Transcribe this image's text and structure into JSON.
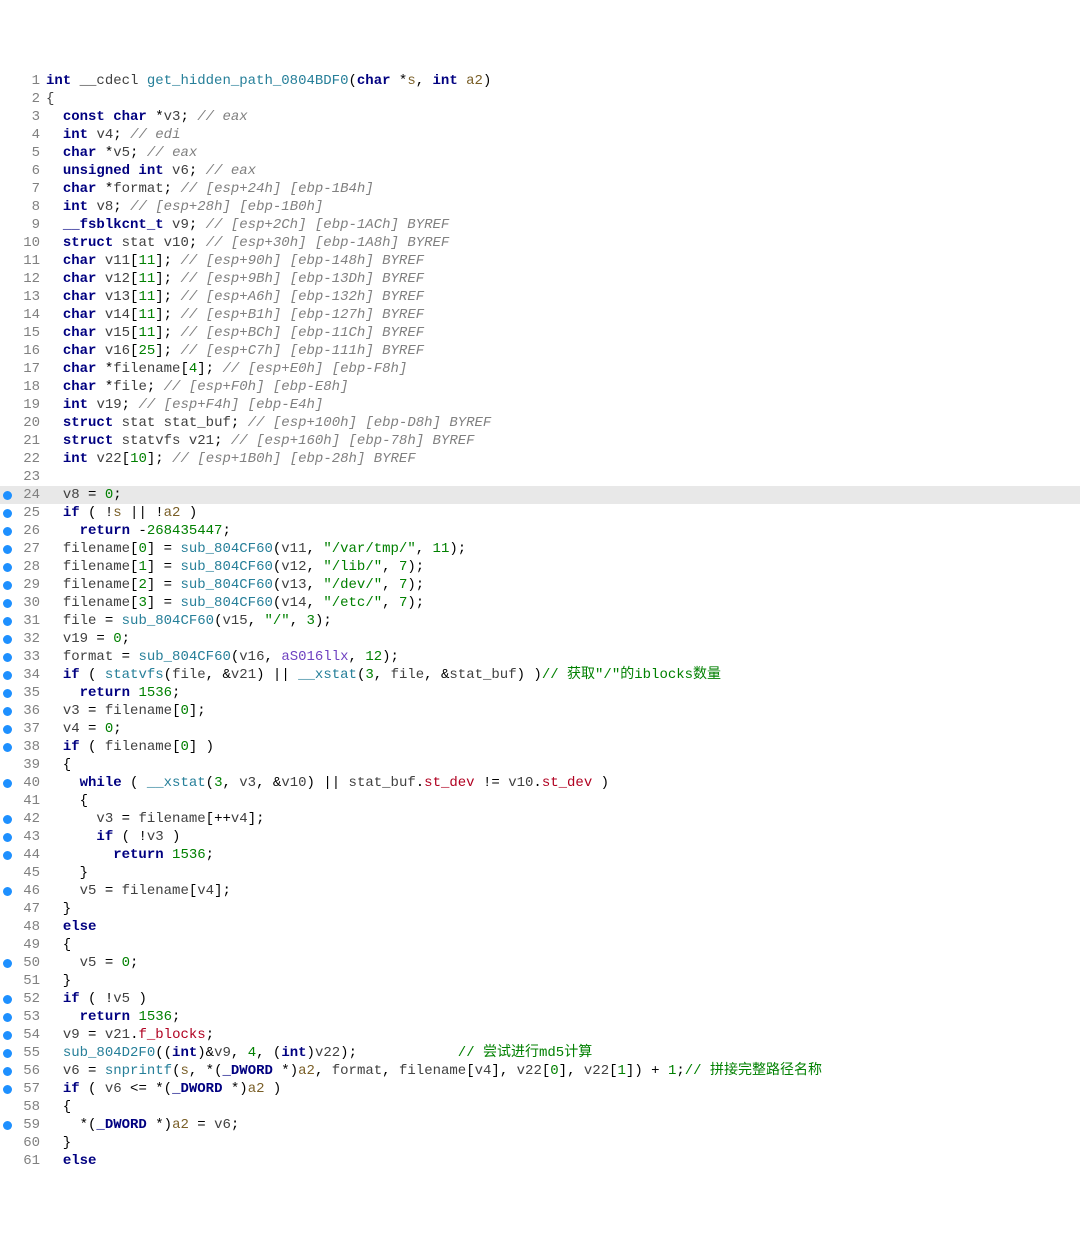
{
  "lines": [
    {
      "n": 1,
      "bp": false,
      "html": "<span class='ty'>int</span> <span class='id'>__cdecl</span> <span class='fn'>get_hidden_path_0804BDF0</span>(<span class='ty'>char</span> *<span class='param'>s</span>, <span class='ty'>int</span> <span class='param'>a2</span>)"
    },
    {
      "n": 2,
      "bp": false,
      "html": "<span class='br'>{</span>"
    },
    {
      "n": 3,
      "bp": false,
      "html": "  <span class='ty'>const char</span> *<span class='var'>v3</span>; <span class='cmt'>// eax</span>"
    },
    {
      "n": 4,
      "bp": false,
      "html": "  <span class='ty'>int</span> <span class='var'>v4</span>; <span class='cmt'>// edi</span>"
    },
    {
      "n": 5,
      "bp": false,
      "html": "  <span class='ty'>char</span> *<span class='var'>v5</span>; <span class='cmt'>// eax</span>"
    },
    {
      "n": 6,
      "bp": false,
      "html": "  <span class='ty'>unsigned int</span> <span class='var'>v6</span>; <span class='cmt'>// eax</span>"
    },
    {
      "n": 7,
      "bp": false,
      "html": "  <span class='ty'>char</span> *<span class='var'>format</span>; <span class='cmt'>// [esp+24h] [ebp-1B4h]</span>"
    },
    {
      "n": 8,
      "bp": false,
      "html": "  <span class='ty'>int</span> <span class='var'>v8</span>; <span class='cmt'>// [esp+28h] [ebp-1B0h]</span>"
    },
    {
      "n": 9,
      "bp": false,
      "html": "  <span class='ty'>__fsblkcnt_t</span> <span class='var'>v9</span>; <span class='cmt'>// [esp+2Ch] [ebp-1ACh] BYREF</span>"
    },
    {
      "n": 10,
      "bp": false,
      "html": "  <span class='ty'>struct</span> <span class='id'>stat</span> <span class='var'>v10</span>; <span class='cmt'>// [esp+30h] [ebp-1A8h] BYREF</span>"
    },
    {
      "n": 11,
      "bp": false,
      "html": "  <span class='ty'>char</span> <span class='var'>v11</span>[<span class='num'>11</span>]; <span class='cmt'>// [esp+90h] [ebp-148h] BYREF</span>"
    },
    {
      "n": 12,
      "bp": false,
      "html": "  <span class='ty'>char</span> <span class='var'>v12</span>[<span class='num'>11</span>]; <span class='cmt'>// [esp+9Bh] [ebp-13Dh] BYREF</span>"
    },
    {
      "n": 13,
      "bp": false,
      "html": "  <span class='ty'>char</span> <span class='var'>v13</span>[<span class='num'>11</span>]; <span class='cmt'>// [esp+A6h] [ebp-132h] BYREF</span>"
    },
    {
      "n": 14,
      "bp": false,
      "html": "  <span class='ty'>char</span> <span class='var'>v14</span>[<span class='num'>11</span>]; <span class='cmt'>// [esp+B1h] [ebp-127h] BYREF</span>"
    },
    {
      "n": 15,
      "bp": false,
      "html": "  <span class='ty'>char</span> <span class='var'>v15</span>[<span class='num'>11</span>]; <span class='cmt'>// [esp+BCh] [ebp-11Ch] BYREF</span>"
    },
    {
      "n": 16,
      "bp": false,
      "html": "  <span class='ty'>char</span> <span class='var'>v16</span>[<span class='num'>25</span>]; <span class='cmt'>// [esp+C7h] [ebp-111h] BYREF</span>"
    },
    {
      "n": 17,
      "bp": false,
      "html": "  <span class='ty'>char</span> *<span class='var'>filename</span>[<span class='num'>4</span>]; <span class='cmt'>// [esp+E0h] [ebp-F8h]</span>"
    },
    {
      "n": 18,
      "bp": false,
      "html": "  <span class='ty'>char</span> *<span class='var'>file</span>; <span class='cmt'>// [esp+F0h] [ebp-E8h]</span>"
    },
    {
      "n": 19,
      "bp": false,
      "html": "  <span class='ty'>int</span> <span class='var'>v19</span>; <span class='cmt'>// [esp+F4h] [ebp-E4h]</span>"
    },
    {
      "n": 20,
      "bp": false,
      "html": "  <span class='ty'>struct</span> <span class='id'>stat</span> <span class='var'>stat_buf</span>; <span class='cmt'>// [esp+100h] [ebp-D8h] BYREF</span>"
    },
    {
      "n": 21,
      "bp": false,
      "html": "  <span class='ty'>struct</span> <span class='id'>statvfs</span> <span class='var'>v21</span>; <span class='cmt'>// [esp+160h] [ebp-78h] BYREF</span>"
    },
    {
      "n": 22,
      "bp": false,
      "html": "  <span class='ty'>int</span> <span class='var'>v22</span>[<span class='num'>10</span>]; <span class='cmt'>// [esp+1B0h] [ebp-28h] BYREF</span>"
    },
    {
      "n": 23,
      "bp": false,
      "html": ""
    },
    {
      "n": 24,
      "bp": true,
      "current": true,
      "html": "  <span class='var'>v8</span> = <span class='num'>0</span>;"
    },
    {
      "n": 25,
      "bp": true,
      "html": "  <span class='kw'>if</span> ( !<span class='param'>s</span> || !<span class='param'>a2</span> )"
    },
    {
      "n": 26,
      "bp": true,
      "html": "    <span class='kw'>return</span> -<span class='num'>268435447</span>;"
    },
    {
      "n": 27,
      "bp": true,
      "html": "  <span class='var'>filename</span>[<span class='num'>0</span>] = <span class='fn'>sub_804CF60</span>(<span class='var'>v11</span>, <span class='str'>\"/var/tmp/\"</span>, <span class='num'>11</span>);"
    },
    {
      "n": 28,
      "bp": true,
      "html": "  <span class='var'>filename</span>[<span class='num'>1</span>] = <span class='fn'>sub_804CF60</span>(<span class='var'>v12</span>, <span class='str'>\"/lib/\"</span>, <span class='num'>7</span>);"
    },
    {
      "n": 29,
      "bp": true,
      "html": "  <span class='var'>filename</span>[<span class='num'>2</span>] = <span class='fn'>sub_804CF60</span>(<span class='var'>v13</span>, <span class='str'>\"/dev/\"</span>, <span class='num'>7</span>);"
    },
    {
      "n": 30,
      "bp": true,
      "html": "  <span class='var'>filename</span>[<span class='num'>3</span>] = <span class='fn'>sub_804CF60</span>(<span class='var'>v14</span>, <span class='str'>\"/etc/\"</span>, <span class='num'>7</span>);"
    },
    {
      "n": 31,
      "bp": true,
      "html": "  <span class='var'>file</span> = <span class='fn'>sub_804CF60</span>(<span class='var'>v15</span>, <span class='str'>\"/\"</span>, <span class='num'>3</span>);"
    },
    {
      "n": 32,
      "bp": true,
      "html": "  <span class='var'>v19</span> = <span class='num'>0</span>;"
    },
    {
      "n": 33,
      "bp": true,
      "html": "  <span class='var'>format</span> = <span class='fn'>sub_804CF60</span>(<span class='var'>v16</span>, <span class='global'>aS016llx</span>, <span class='num'>12</span>);"
    },
    {
      "n": 34,
      "bp": true,
      "html": "  <span class='kw'>if</span> ( <span class='fn'>statvfs</span>(<span class='var'>file</span>, &amp;<span class='var'>v21</span>) || <span class='fn'>__xstat</span>(<span class='num'>3</span>, <span class='var'>file</span>, &amp;<span class='var'>stat_buf</span>) )<span class='cmt2'>// 获取\"/\"的iblocks数量</span>"
    },
    {
      "n": 35,
      "bp": true,
      "html": "    <span class='kw'>return</span> <span class='num'>1536</span>;"
    },
    {
      "n": 36,
      "bp": true,
      "html": "  <span class='var'>v3</span> = <span class='var'>filename</span>[<span class='num'>0</span>];"
    },
    {
      "n": 37,
      "bp": true,
      "html": "  <span class='var'>v4</span> = <span class='num'>0</span>;"
    },
    {
      "n": 38,
      "bp": true,
      "html": "  <span class='kw'>if</span> ( <span class='var'>filename</span>[<span class='num'>0</span>] )"
    },
    {
      "n": 39,
      "bp": false,
      "html": "  {"
    },
    {
      "n": 40,
      "bp": true,
      "html": "    <span class='kw'>while</span> ( <span class='fn'>__xstat</span>(<span class='num'>3</span>, <span class='var'>v3</span>, &amp;<span class='var'>v10</span>) || <span class='var'>stat_buf</span>.<span class='mem'>st_dev</span> != <span class='var'>v10</span>.<span class='mem'>st_dev</span> )"
    },
    {
      "n": 41,
      "bp": false,
      "html": "    {"
    },
    {
      "n": 42,
      "bp": true,
      "html": "      <span class='var'>v3</span> = <span class='var'>filename</span>[++<span class='var'>v4</span>];"
    },
    {
      "n": 43,
      "bp": true,
      "html": "      <span class='kw'>if</span> ( !<span class='var'>v3</span> )"
    },
    {
      "n": 44,
      "bp": true,
      "html": "        <span class='kw'>return</span> <span class='num'>1536</span>;"
    },
    {
      "n": 45,
      "bp": false,
      "html": "    }"
    },
    {
      "n": 46,
      "bp": true,
      "html": "    <span class='var'>v5</span> = <span class='var'>filename</span>[<span class='var'>v4</span>];"
    },
    {
      "n": 47,
      "bp": false,
      "html": "  }"
    },
    {
      "n": 48,
      "bp": false,
      "html": "  <span class='kw'>else</span>"
    },
    {
      "n": 49,
      "bp": false,
      "html": "  {"
    },
    {
      "n": 50,
      "bp": true,
      "html": "    <span class='var'>v5</span> = <span class='num'>0</span>;"
    },
    {
      "n": 51,
      "bp": false,
      "html": "  }"
    },
    {
      "n": 52,
      "bp": true,
      "html": "  <span class='kw'>if</span> ( !<span class='var'>v5</span> )"
    },
    {
      "n": 53,
      "bp": true,
      "html": "    <span class='kw'>return</span> <span class='num'>1536</span>;"
    },
    {
      "n": 54,
      "bp": true,
      "html": "  <span class='var'>v9</span> = <span class='var'>v21</span>.<span class='mem'>f_blocks</span>;"
    },
    {
      "n": 55,
      "bp": true,
      "html": "  <span class='fn'>sub_804D2F0</span>((<span class='ty'>int</span>)&amp;<span class='var'>v9</span>, <span class='num'>4</span>, (<span class='ty'>int</span>)<span class='var'>v22</span>);            <span class='cmt2'>// 尝试进行md5计算</span>"
    },
    {
      "n": 56,
      "bp": true,
      "html": "  <span class='var'>v6</span> = <span class='fn'>snprintf</span>(<span class='param'>s</span>, *(<span class='ty'>_DWORD</span> *)<span class='param'>a2</span>, <span class='var'>format</span>, <span class='var'>filename</span>[<span class='var'>v4</span>], <span class='var'>v22</span>[<span class='num'>0</span>], <span class='var'>v22</span>[<span class='num'>1</span>]) + <span class='num'>1</span>;<span class='cmt2'>// 拼接完整路径名称</span>"
    },
    {
      "n": 57,
      "bp": true,
      "html": "  <span class='kw'>if</span> ( <span class='var'>v6</span> &lt;= *(<span class='ty'>_DWORD</span> *)<span class='param'>a2</span> )"
    },
    {
      "n": 58,
      "bp": false,
      "html": "  {"
    },
    {
      "n": 59,
      "bp": true,
      "html": "    *(<span class='ty'>_DWORD</span> *)<span class='param'>a2</span> = <span class='var'>v6</span>;"
    },
    {
      "n": 60,
      "bp": false,
      "html": "  }"
    },
    {
      "n": 61,
      "bp": false,
      "html": "  <span class='kw'>else</span>"
    }
  ]
}
